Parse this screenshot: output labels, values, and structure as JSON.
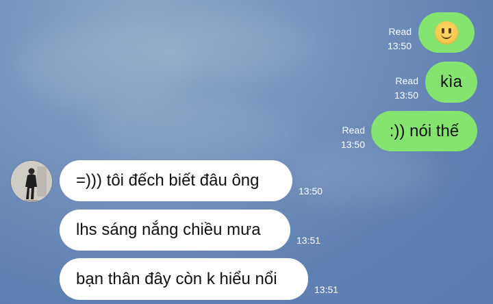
{
  "colors": {
    "background": "#6f8dbb",
    "outgoing_bubble": "#85e36f",
    "incoming_bubble": "#ffffff",
    "meta_text": "#ffffff"
  },
  "messages": [
    {
      "direction": "outgoing",
      "content": "",
      "content_icon": "slightly-smiling-face-emoji",
      "read_label": "Read",
      "time": "13:50"
    },
    {
      "direction": "outgoing",
      "content": "kìa",
      "read_label": "Read",
      "time": "13:50"
    },
    {
      "direction": "outgoing",
      "content": ":)) nói thế",
      "read_label": "Read",
      "time": "13:50"
    },
    {
      "direction": "incoming",
      "content": "=))) tôi đếch biết đâu ông",
      "time": "13:50"
    },
    {
      "direction": "incoming",
      "content": "lhs sáng nắng chiều mưa",
      "time": "13:51"
    },
    {
      "direction": "incoming",
      "content": "bạn thân đây còn k hiểu nổi",
      "time": "13:51"
    }
  ]
}
